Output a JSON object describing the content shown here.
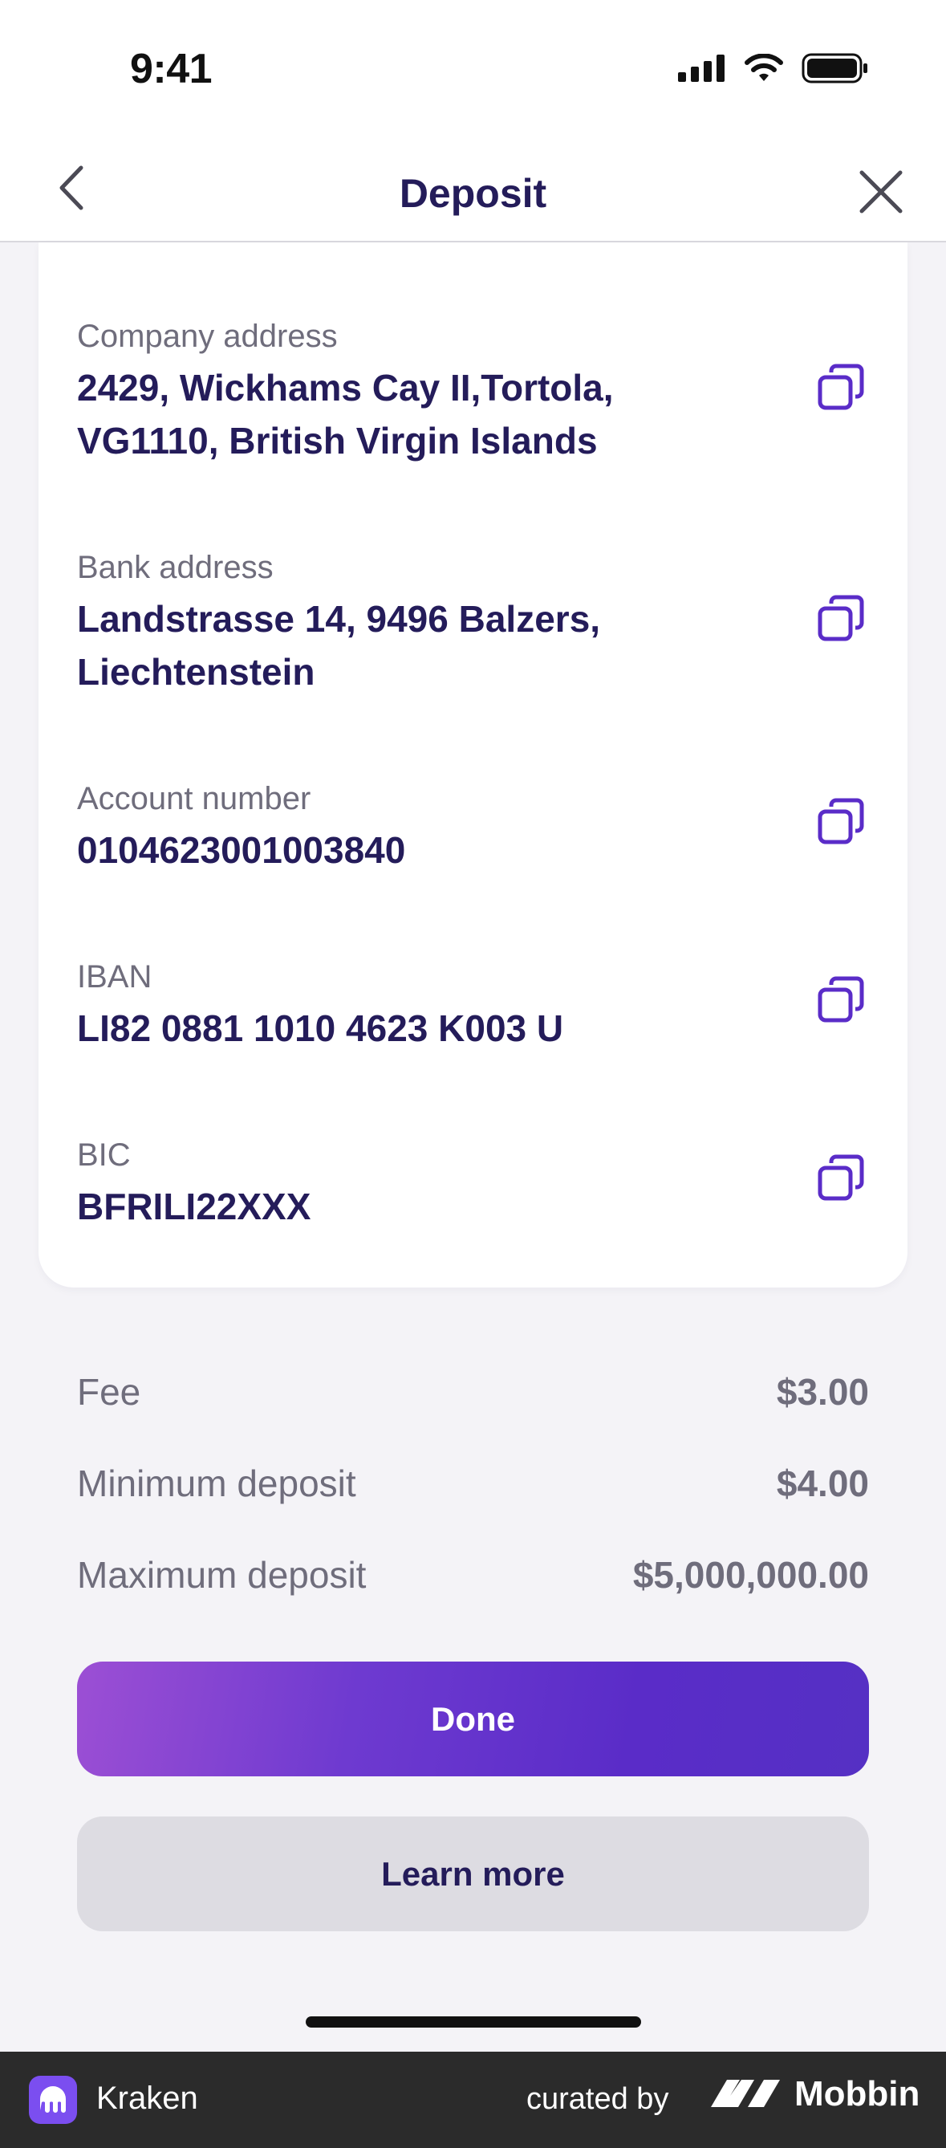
{
  "status_bar": {
    "time": "9:41"
  },
  "nav": {
    "title": "Deposit"
  },
  "bank_details": [
    {
      "label": "Company address",
      "value_lines": [
        "2429, Wickhams Cay II,Tortola,",
        "VG1110, British Virgin Islands"
      ]
    },
    {
      "label": "Bank address",
      "value_lines": [
        "Landstrasse 14, 9496 Balzers,",
        "Liechtenstein"
      ]
    },
    {
      "label": "Account number",
      "value_lines": [
        "0104623001003840"
      ]
    },
    {
      "label": "IBAN",
      "value_lines": [
        "LI82 0881 1010 4623 K003 U"
      ]
    },
    {
      "label": "BIC",
      "value_lines": [
        "BFRILI22XXX"
      ]
    }
  ],
  "summary": [
    {
      "label": "Fee",
      "value": "$3.00"
    },
    {
      "label": "Minimum deposit",
      "value": "$4.00"
    },
    {
      "label": "Maximum deposit",
      "value": "$5,000,000.00"
    }
  ],
  "buttons": {
    "done": "Done",
    "learn_more": "Learn more"
  },
  "footer": {
    "app_name": "Kraken",
    "curated_by": "curated by",
    "brand": "Mobbin"
  },
  "colors": {
    "accent": "#5a2cc8",
    "text_primary": "#241c5a",
    "text_secondary": "#6f6d7c"
  }
}
